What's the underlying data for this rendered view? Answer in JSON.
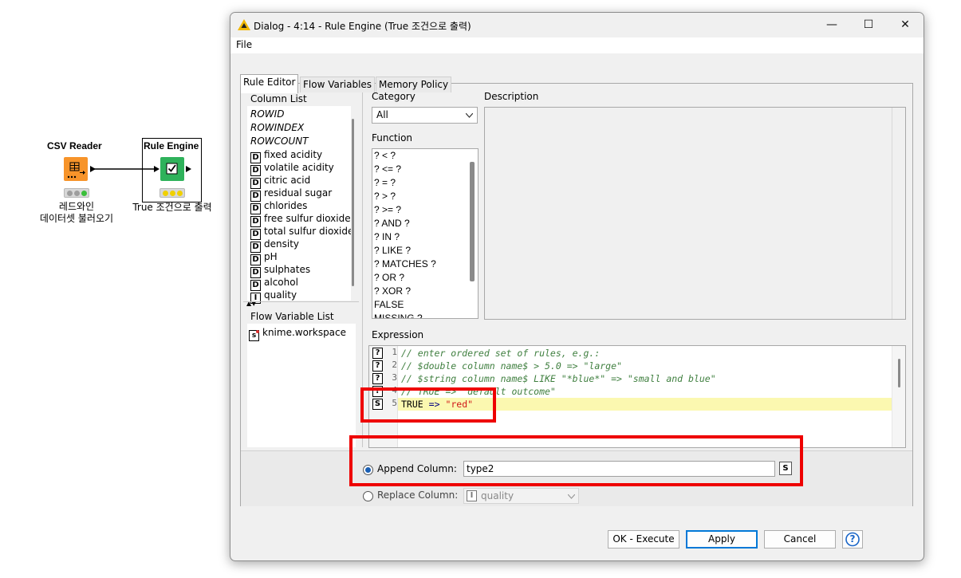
{
  "workflow": {
    "csv_reader": {
      "title": "CSV Reader",
      "label_line1": "레드와인",
      "label_line2": "데이터셋 불러오기",
      "icon_color": "#f7942a"
    },
    "rule_engine": {
      "title": "Rule Engine",
      "label": "True 조건으로 출력",
      "icon_color": "#2fb25b"
    }
  },
  "dialog": {
    "title": "Dialog - 4:14 - Rule Engine (True 조건으로 출력)",
    "window_controls": {
      "minimize": "—",
      "maximize": "☐",
      "close": "✕"
    },
    "menu": {
      "file": "File"
    },
    "tabs": [
      {
        "label": "Rule Editor",
        "active": true
      },
      {
        "label": "Flow Variables",
        "active": false
      },
      {
        "label": "Memory Policy",
        "active": false
      }
    ],
    "column_list": {
      "label": "Column List",
      "special": [
        "ROWID",
        "ROWINDEX",
        "ROWCOUNT"
      ],
      "columns": [
        {
          "type": "D",
          "name": "fixed acidity"
        },
        {
          "type": "D",
          "name": "volatile acidity"
        },
        {
          "type": "D",
          "name": "citric acid"
        },
        {
          "type": "D",
          "name": "residual sugar"
        },
        {
          "type": "D",
          "name": "chlorides"
        },
        {
          "type": "D",
          "name": "free sulfur dioxide"
        },
        {
          "type": "D",
          "name": "total sulfur dioxide"
        },
        {
          "type": "D",
          "name": "density"
        },
        {
          "type": "D",
          "name": "pH"
        },
        {
          "type": "D",
          "name": "sulphates"
        },
        {
          "type": "D",
          "name": "alcohol"
        },
        {
          "type": "I",
          "name": "quality"
        }
      ]
    },
    "flow_variable_list": {
      "label": "Flow Variable List",
      "items": [
        {
          "type": "s",
          "name": "knime.workspace"
        }
      ]
    },
    "category": {
      "label": "Category",
      "value": "All"
    },
    "function": {
      "label": "Function",
      "items": [
        "? < ?",
        "? <= ?",
        "? = ?",
        "? > ?",
        "? >= ?",
        "? AND ?",
        "? IN ?",
        "? LIKE ?",
        "? MATCHES ?",
        "? OR ?",
        "? XOR ?",
        "FALSE",
        "MISSING ?"
      ]
    },
    "description": {
      "label": "Description"
    },
    "expression": {
      "label": "Expression",
      "lines": [
        {
          "no": "1",
          "icon": "?",
          "text": "// enter ordered set of rules, e.g.:"
        },
        {
          "no": "2",
          "icon": "?",
          "text": "// $double column name$ > 5.0 => \"large\""
        },
        {
          "no": "3",
          "icon": "?",
          "text": "// $string column name$ LIKE \"*blue*\" => \"small and blue\""
        },
        {
          "no": "4",
          "icon": "?",
          "text": "// TRUE => \"default outcome\""
        },
        {
          "no": "5",
          "icon": "S",
          "keyword": "TRUE",
          "arrow": "=>",
          "string": "\"red\""
        }
      ]
    },
    "append_column": {
      "label": "Append Column:",
      "value": "type2",
      "type_button": "S",
      "selected": true
    },
    "replace_column": {
      "label": "Replace Column:",
      "type": "I",
      "value": "quality",
      "selected": false
    },
    "buttons": {
      "ok_execute": "OK - Execute",
      "apply": "Apply",
      "cancel": "Cancel",
      "help": "?"
    },
    "colors": {
      "highlight_line": "#fbf8b0",
      "comment": "#3f7f3f",
      "string": "#d01919",
      "keyword": "#000080",
      "annotation": "#ee0000"
    }
  }
}
